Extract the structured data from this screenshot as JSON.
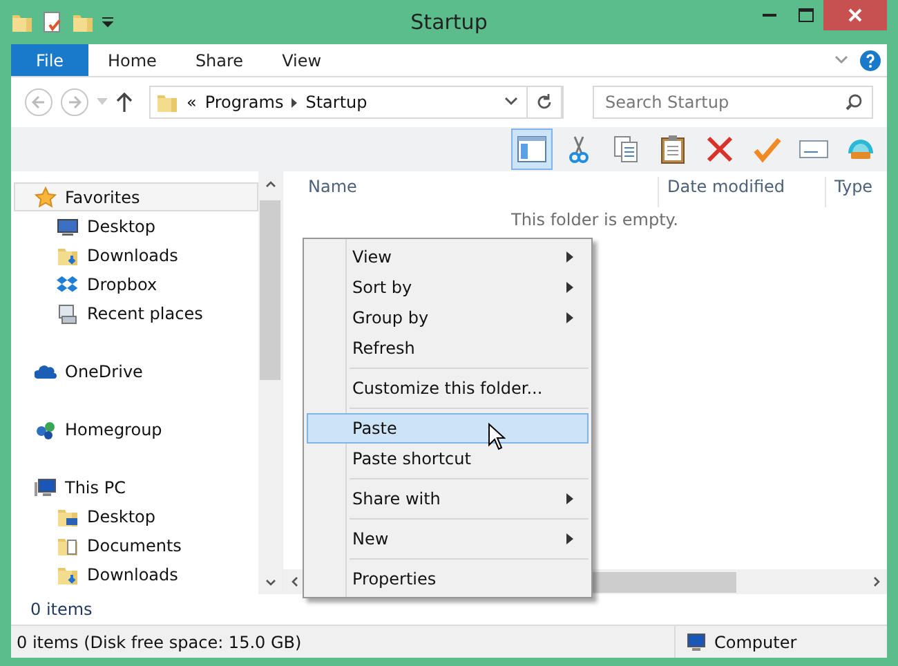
{
  "window": {
    "title": "Startup"
  },
  "ribbon": {
    "tabs": [
      {
        "label": "File",
        "kind": "file"
      },
      {
        "label": "Home",
        "kind": "tab"
      },
      {
        "label": "Share",
        "kind": "tab"
      },
      {
        "label": "View",
        "kind": "tab"
      }
    ]
  },
  "address": {
    "overflow": "«",
    "crumbs": [
      "Programs",
      "Startup"
    ]
  },
  "search": {
    "placeholder": "Search Startup"
  },
  "toolbar": {
    "buttons": [
      {
        "selected": true
      },
      {
        "selected": false
      },
      {
        "selected": false
      },
      {
        "selected": false
      },
      {
        "selected": false
      },
      {
        "selected": false
      },
      {
        "selected": false
      },
      {
        "selected": false
      }
    ]
  },
  "navigation": {
    "groups": [
      {
        "label": "Favorites",
        "selected": true,
        "children": [
          {
            "label": "Desktop",
            "selected": false
          },
          {
            "label": "Downloads",
            "selected": false
          },
          {
            "label": "Dropbox",
            "selected": false
          },
          {
            "label": "Recent places",
            "selected": false
          }
        ]
      },
      {
        "label": "OneDrive",
        "selected": false
      },
      {
        "label": "Homegroup",
        "selected": false
      },
      {
        "label": "This PC",
        "selected": false,
        "children": [
          {
            "label": "Desktop",
            "selected": false
          },
          {
            "label": "Documents",
            "selected": false
          },
          {
            "label": "Downloads",
            "selected": false
          }
        ]
      }
    ]
  },
  "columns": [
    "Name",
    "Date modified",
    "Type"
  ],
  "empty_message": "This folder is empty.",
  "context_menu": {
    "items": [
      {
        "kind": "item",
        "label": "View",
        "submenu": true,
        "selected": false
      },
      {
        "kind": "item",
        "label": "Sort by",
        "submenu": true,
        "selected": false
      },
      {
        "kind": "item",
        "label": "Group by",
        "submenu": true,
        "selected": false
      },
      {
        "kind": "item",
        "label": "Refresh",
        "submenu": false,
        "selected": false
      },
      {
        "kind": "separator"
      },
      {
        "kind": "item",
        "label": "Customize this folder...",
        "submenu": false,
        "selected": false
      },
      {
        "kind": "separator"
      },
      {
        "kind": "item",
        "label": "Paste",
        "submenu": false,
        "selected": true
      },
      {
        "kind": "item",
        "label": "Paste shortcut",
        "submenu": false,
        "selected": false
      },
      {
        "kind": "separator"
      },
      {
        "kind": "item",
        "label": "Share with",
        "submenu": true,
        "selected": false
      },
      {
        "kind": "separator"
      },
      {
        "kind": "item",
        "label": "New",
        "submenu": true,
        "selected": false
      },
      {
        "kind": "separator"
      },
      {
        "kind": "item",
        "label": "Properties",
        "submenu": false,
        "selected": false
      }
    ]
  },
  "details": "0 items",
  "status_bar": {
    "text": "0 items (Disk free space: 15.0 GB)",
    "location": "Computer"
  }
}
